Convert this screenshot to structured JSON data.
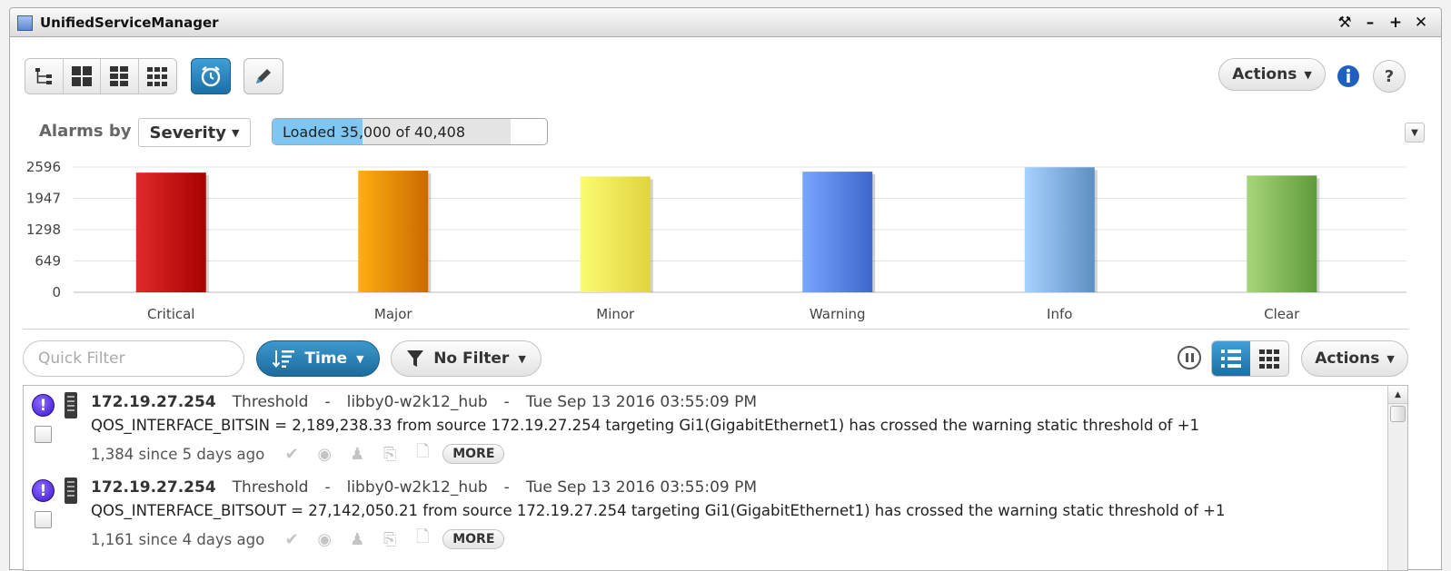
{
  "window": {
    "title": "UnifiedServiceManager",
    "controls": [
      "⚒",
      "–",
      "+",
      "✕"
    ]
  },
  "toolbar": {
    "actions_label": "Actions"
  },
  "alarms_by": {
    "label": "Alarms by",
    "selected": "Severity"
  },
  "progress": {
    "text": "Loaded 35,000 of 40,408",
    "loaded": 35000,
    "total": 40408
  },
  "chart_data": {
    "type": "bar",
    "categories": [
      "Critical",
      "Major",
      "Minor",
      "Warning",
      "Info",
      "Clear"
    ],
    "values": [
      2480,
      2520,
      2400,
      2500,
      2590,
      2420
    ],
    "yticks": [
      0,
      649,
      1298,
      1947,
      2596
    ],
    "ylim": [
      0,
      2596
    ],
    "colors": [
      [
        "#e02a2a",
        "#a80000"
      ],
      [
        "#ffae12",
        "#c96a00"
      ],
      [
        "#fbfb70",
        "#e0d440"
      ],
      [
        "#79a6ff",
        "#3e66cc"
      ],
      [
        "#a8d2ff",
        "#5d8fc2"
      ],
      [
        "#a7d67a",
        "#5e9a3a"
      ]
    ],
    "grid": true,
    "legend": "none"
  },
  "list_toolbar": {
    "quick_filter_placeholder": "Quick Filter",
    "sort_label": "Time",
    "filter_label": "No Filter",
    "actions_label": "Actions"
  },
  "alarms": [
    {
      "ip": "172.19.27.254",
      "type": "Threshold",
      "sep": "-",
      "device": "libby0-w2k12_hub",
      "time": "Tue Sep 13 2016 03:55:09 PM",
      "message": "QOS_INTERFACE_BITSIN = 2,189,238.33 from source 172.19.27.254 targeting Gi1(GigabitEthernet1) has crossed the warning static threshold of +1",
      "count": "1,384 since 5 days ago",
      "more": "MORE"
    },
    {
      "ip": "172.19.27.254",
      "type": "Threshold",
      "sep": "-",
      "device": "libby0-w2k12_hub",
      "time": "Tue Sep 13 2016 03:55:09 PM",
      "message": "QOS_INTERFACE_BITSOUT = 27,142,050.21 from source 172.19.27.254 targeting Gi1(GigabitEthernet1) has crossed the warning static threshold of +1",
      "count": "1,161 since 4 days ago",
      "more": "MORE"
    }
  ]
}
